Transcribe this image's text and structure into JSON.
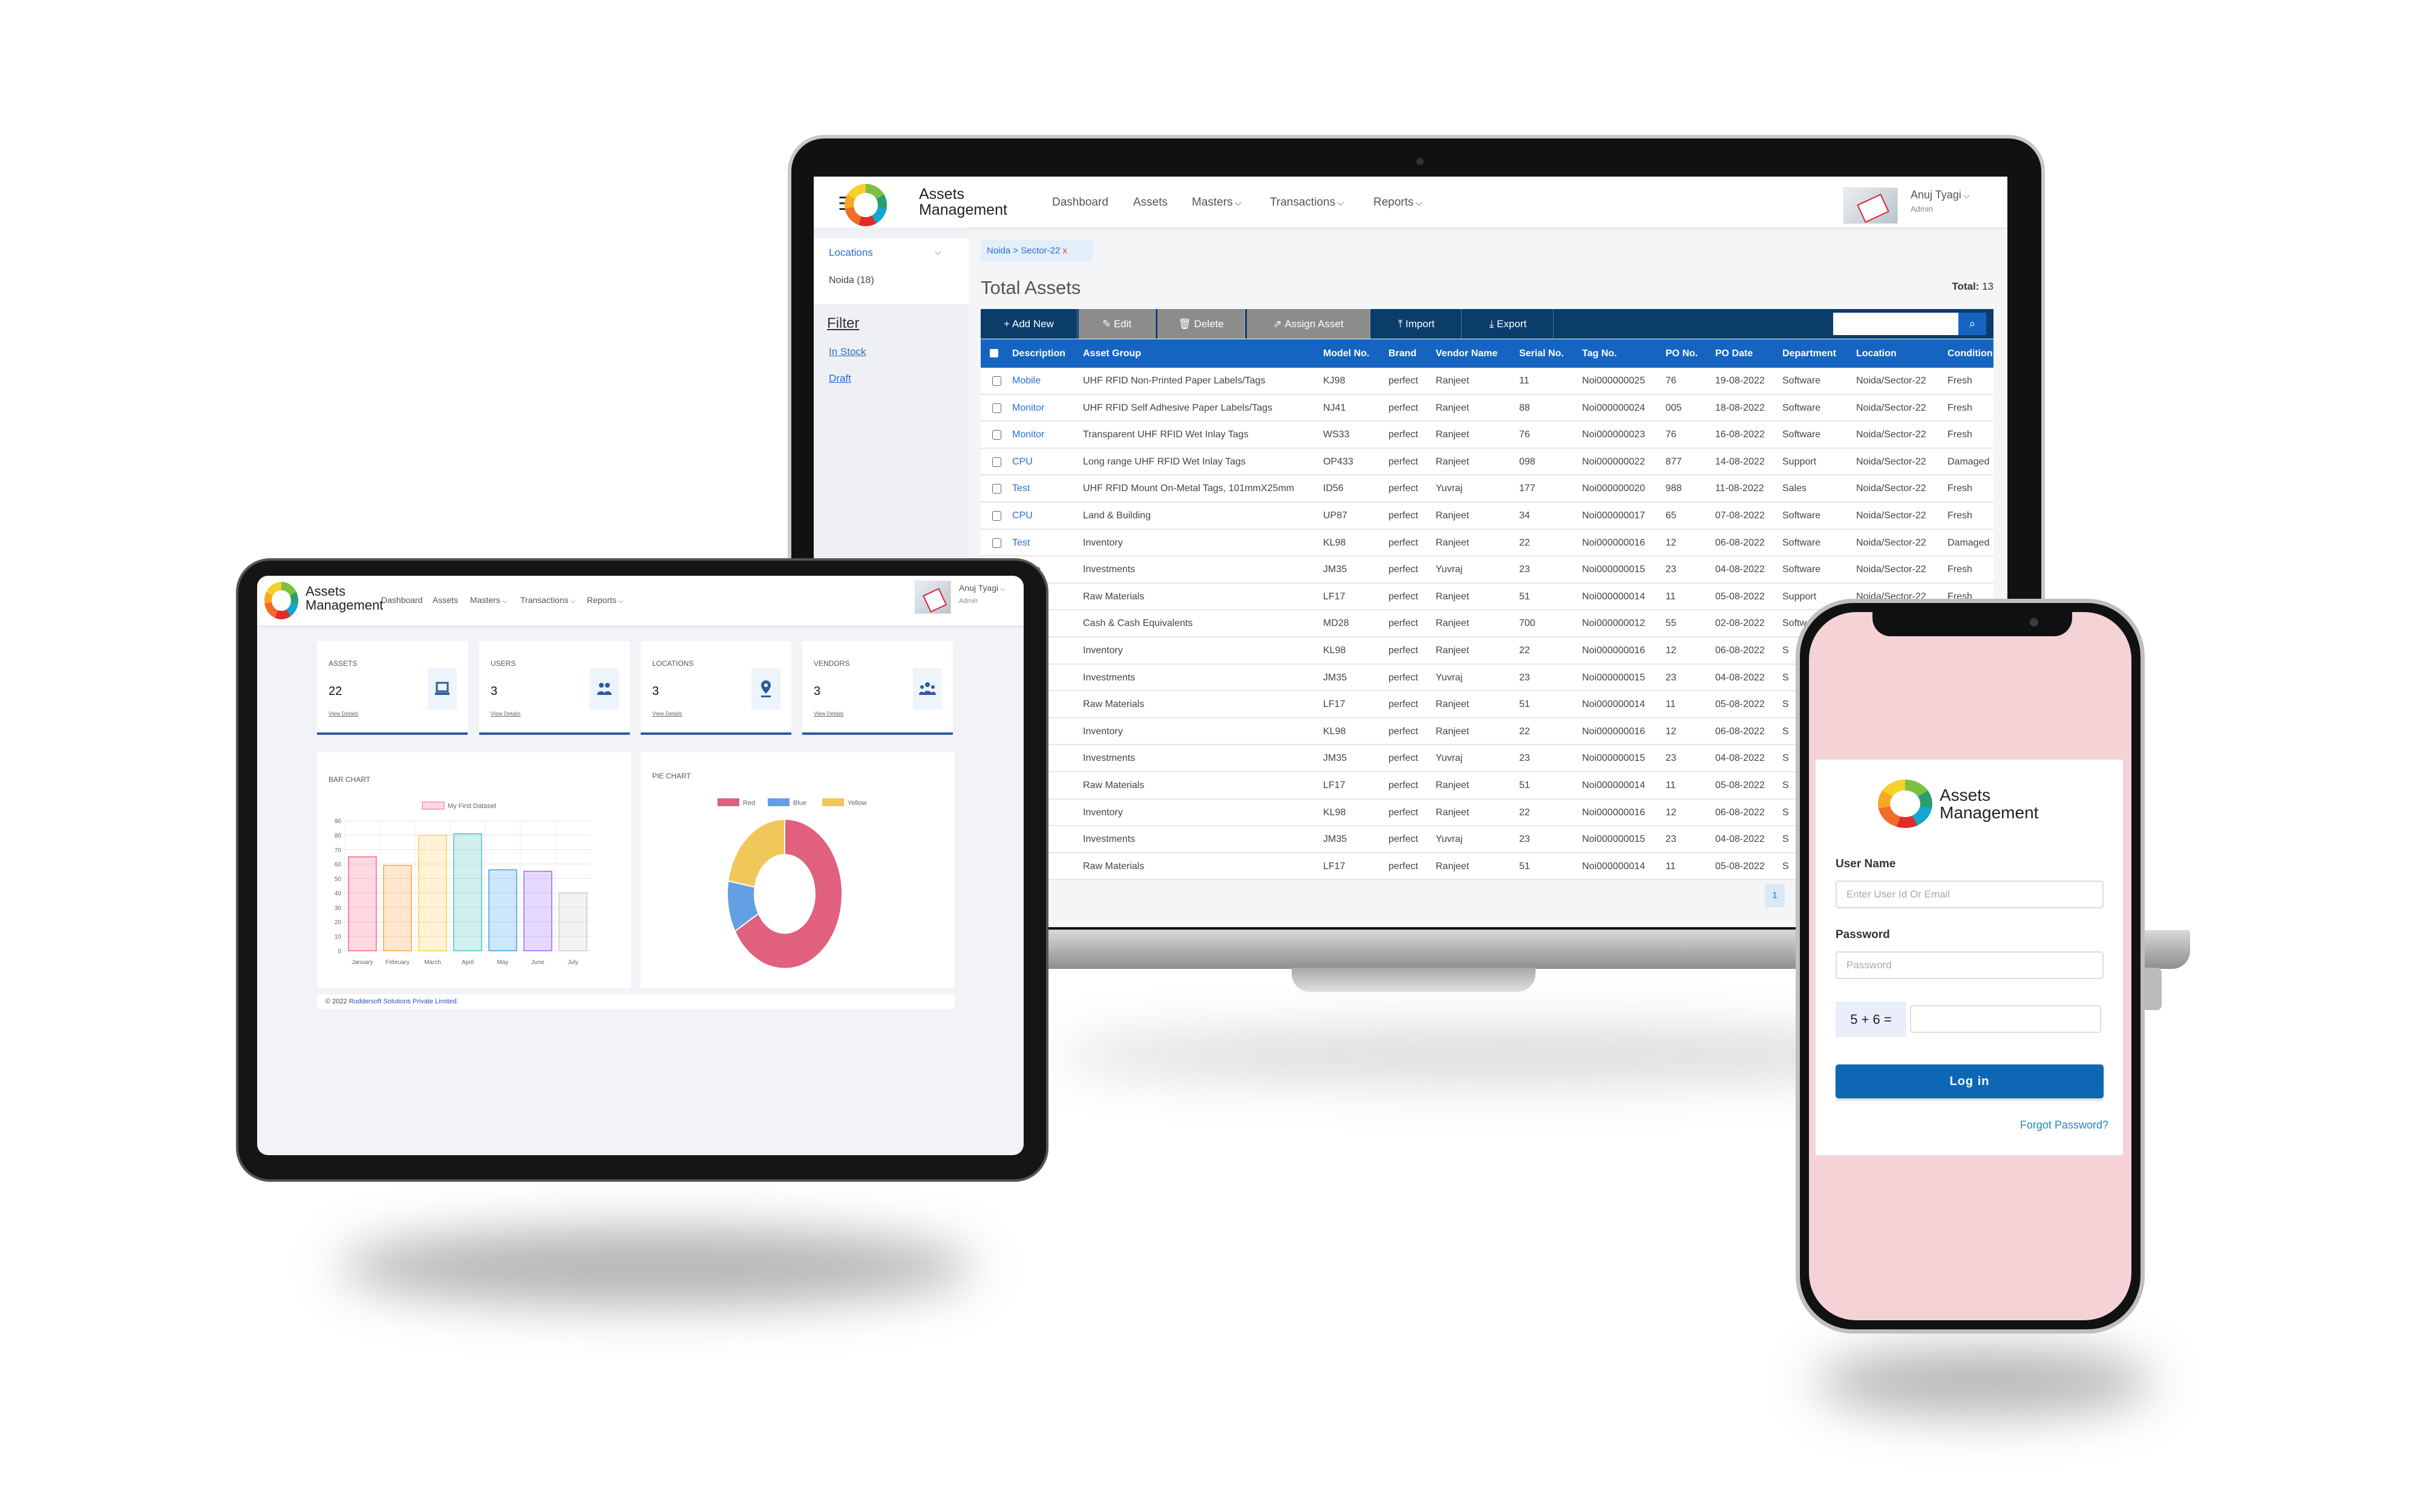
{
  "app": {
    "name_line1": "Assets",
    "name_line2": "Management"
  },
  "nav": {
    "items": [
      "Dashboard",
      "Assets",
      "Masters",
      "Transactions",
      "Reports"
    ],
    "dropdown": [
      false,
      false,
      true,
      true,
      true
    ]
  },
  "user": {
    "name": "Anuj Tyagi",
    "role": "Admin"
  },
  "laptop": {
    "sidebar": {
      "locations_label": "Locations",
      "location_item": "Noida (18)",
      "filter_title": "Filter",
      "filters": [
        "In Stock",
        "Draft"
      ]
    },
    "breadcrumb": {
      "text": "Noida > Sector-22",
      "close": "x"
    },
    "page_title": "Total Assets",
    "total_label": "Total:",
    "total_value": "13",
    "toolbar": {
      "buttons": [
        {
          "label": "+ Add New",
          "icon": "plus-icon",
          "enabled": true
        },
        {
          "label": "Edit",
          "icon": "edit-icon",
          "enabled": false
        },
        {
          "label": "Delete",
          "icon": "trash-icon",
          "enabled": false
        },
        {
          "label": "Assign Asset",
          "icon": "assign-icon",
          "enabled": false
        },
        {
          "label": "Import",
          "icon": "upload-icon",
          "enabled": true
        },
        {
          "label": "Export",
          "icon": "download-icon",
          "enabled": true
        }
      ],
      "search_placeholder": ""
    },
    "table": {
      "columns": [
        "Description",
        "Asset Group",
        "Model No.",
        "Brand",
        "Vendor Name",
        "Serial No.",
        "Tag No.",
        "PO No.",
        "PO Date",
        "Department",
        "Location",
        "Condition"
      ],
      "rows": [
        [
          "Mobile",
          "UHF RFID Non-Printed Paper Labels/Tags",
          "KJ98",
          "perfect",
          "Ranjeet",
          "11",
          "Noi000000025",
          "76",
          "19-08-2022",
          "Software",
          "Noida/Sector-22",
          "Fresh"
        ],
        [
          "Monitor",
          "UHF RFID Self Adhesive Paper Labels/Tags",
          "NJ41",
          "perfect",
          "Ranjeet",
          "88",
          "Noi000000024",
          "005",
          "18-08-2022",
          "Software",
          "Noida/Sector-22",
          "Fresh"
        ],
        [
          "Monitor",
          "Transparent UHF RFID Wet Inlay Tags",
          "WS33",
          "perfect",
          "Ranjeet",
          "76",
          "Noi000000023",
          "76",
          "16-08-2022",
          "Software",
          "Noida/Sector-22",
          "Fresh"
        ],
        [
          "CPU",
          "Long range UHF RFID Wet Inlay Tags",
          "OP433",
          "perfect",
          "Ranjeet",
          "098",
          "Noi000000022",
          "877",
          "14-08-2022",
          "Support",
          "Noida/Sector-22",
          "Damaged"
        ],
        [
          "Test",
          "UHF RFID Mount On-Metal Tags, 101mmX25mm",
          "ID56",
          "perfect",
          "Yuvraj",
          "177",
          "Noi000000020",
          "988",
          "11-08-2022",
          "Sales",
          "Noida/Sector-22",
          "Fresh"
        ],
        [
          "CPU",
          "Land & Building",
          "UP87",
          "perfect",
          "Ranjeet",
          "34",
          "Noi000000017",
          "65",
          "07-08-2022",
          "Software",
          "Noida/Sector-22",
          "Fresh"
        ],
        [
          "Test",
          "Inventory",
          "KL98",
          "perfect",
          "Ranjeet",
          "22",
          "Noi000000016",
          "12",
          "06-08-2022",
          "Software",
          "Noida/Sector-22",
          "Damaged"
        ],
        [
          "Mobile",
          "Investments",
          "JM35",
          "perfect",
          "Yuvraj",
          "23",
          "Noi000000015",
          "23",
          "04-08-2022",
          "Software",
          "Noida/Sector-22",
          "Fresh"
        ],
        [
          "",
          "Raw Materials",
          "LF17",
          "perfect",
          "Ranjeet",
          "51",
          "Noi000000014",
          "11",
          "05-08-2022",
          "Support",
          "Noida/Sector-22",
          "Fresh"
        ],
        [
          "",
          "Cash & Cash Equivalents",
          "MD28",
          "perfect",
          "Ranjeet",
          "700",
          "Noi000000012",
          "55",
          "02-08-2022",
          "Software",
          "",
          ""
        ],
        [
          "",
          "Inventory",
          "KL98",
          "perfect",
          "Ranjeet",
          "22",
          "Noi000000016",
          "12",
          "06-08-2022",
          "S",
          "",
          ""
        ],
        [
          "",
          "Investments",
          "JM35",
          "perfect",
          "Yuvraj",
          "23",
          "Noi000000015",
          "23",
          "04-08-2022",
          "S",
          "",
          ""
        ],
        [
          "",
          "Raw Materials",
          "LF17",
          "perfect",
          "Ranjeet",
          "51",
          "Noi000000014",
          "11",
          "05-08-2022",
          "S",
          "",
          ""
        ],
        [
          "",
          "Inventory",
          "KL98",
          "perfect",
          "Ranjeet",
          "22",
          "Noi000000016",
          "12",
          "06-08-2022",
          "S",
          "",
          ""
        ],
        [
          "",
          "Investments",
          "JM35",
          "perfect",
          "Yuvraj",
          "23",
          "Noi000000015",
          "23",
          "04-08-2022",
          "S",
          "",
          ""
        ],
        [
          "",
          "Raw Materials",
          "LF17",
          "perfect",
          "Ranjeet",
          "51",
          "Noi000000014",
          "11",
          "05-08-2022",
          "S",
          "",
          ""
        ],
        [
          "",
          "Inventory",
          "KL98",
          "perfect",
          "Ranjeet",
          "22",
          "Noi000000016",
          "12",
          "06-08-2022",
          "S",
          "",
          ""
        ],
        [
          "",
          "Investments",
          "JM35",
          "perfect",
          "Yuvraj",
          "23",
          "Noi000000015",
          "23",
          "04-08-2022",
          "S",
          "",
          ""
        ],
        [
          "",
          "Raw Materials",
          "LF17",
          "perfect",
          "Ranjeet",
          "51",
          "Noi000000014",
          "11",
          "05-08-2022",
          "S",
          "",
          ""
        ]
      ]
    },
    "pagination": {
      "current": "1"
    }
  },
  "tablet": {
    "cards": [
      {
        "label": "ASSETS",
        "value": "22",
        "link": "View Details",
        "icon": "laptop-icon"
      },
      {
        "label": "USERS",
        "value": "3",
        "link": "View Details",
        "icon": "users-icon"
      },
      {
        "label": "LOCATIONS",
        "value": "3",
        "link": "View Details",
        "icon": "location-pin-icon"
      },
      {
        "label": "VENDORS",
        "value": "3",
        "link": "View Details",
        "icon": "vendors-icon"
      }
    ],
    "footer": {
      "prefix": "© 2022",
      "company": "Ruddersoft Solutions Private Limited."
    }
  },
  "chart_data": [
    {
      "type": "bar",
      "title": "BAR CHART",
      "categories": [
        "January",
        "February",
        "March",
        "April",
        "May",
        "June",
        "July"
      ],
      "series": [
        {
          "name": "My First Dataset",
          "values": [
            65,
            59,
            80,
            81,
            56,
            55,
            40
          ]
        }
      ],
      "ylim": [
        0,
        90
      ],
      "yticks": [
        0,
        10,
        20,
        30,
        40,
        50,
        60,
        70,
        80,
        90
      ],
      "grid": true,
      "legend": "top",
      "colors": [
        "#ff6384",
        "#ff9f40",
        "#ffcd56",
        "#4bc0c0",
        "#36a2eb",
        "#9966ff",
        "#c9cbcf"
      ]
    },
    {
      "type": "pie",
      "variant": "doughnut",
      "title": "PIE CHART",
      "categories": [
        "Red",
        "Blue",
        "Yellow"
      ],
      "values": [
        300,
        50,
        100
      ],
      "colors": [
        "#e0607e",
        "#63a0e3",
        "#f0c85a"
      ],
      "legend": "top"
    }
  ],
  "login": {
    "username_label": "User Name",
    "username_placeholder": "Enter User Id Or Email",
    "password_label": "Password",
    "password_placeholder": "Password",
    "captcha": "5 + 6 =",
    "captcha_value": "",
    "submit": "Log in",
    "forgot": "Forgot Password?"
  },
  "colors": {
    "toolbar": "#0b3d6b",
    "table_header": "#1565c0",
    "link": "#1e6fd9",
    "login_button": "#0d67b5",
    "phone_bg": "#f4d2d5"
  }
}
